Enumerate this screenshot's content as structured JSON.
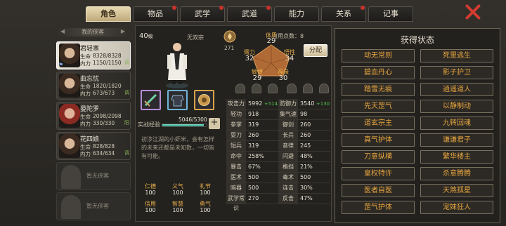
{
  "tabs": [
    {
      "label": "角色",
      "dot": false
    },
    {
      "label": "物品",
      "dot": true
    },
    {
      "label": "武学",
      "dot": true
    },
    {
      "label": "武道",
      "dot": true
    },
    {
      "label": "能力",
      "dot": false
    },
    {
      "label": "关系",
      "dot": true
    },
    {
      "label": "记事",
      "dot": false
    }
  ],
  "list_header": "我的侠客",
  "members": [
    {
      "name": "君轻寒",
      "hp_label": "生命",
      "hp": "8328/8328",
      "mp_label": "内力",
      "mp": "1150/1150",
      "tag": "调"
    },
    {
      "name": "曲忘忧",
      "hp_label": "生命",
      "hp": "1820/1820",
      "mp_label": "内力",
      "mp": "673/673",
      "tag": "调"
    },
    {
      "name": "曼陀罗",
      "hp_label": "生命",
      "hp": "2098/2098",
      "mp_label": "内力",
      "mp": "330/330",
      "tag": "阳"
    },
    {
      "name": "花四娘",
      "hp_label": "生命",
      "hp": "828/828",
      "mp_label": "内力",
      "mp": "634/634",
      "tag": "调"
    }
  ],
  "empty_slots": [
    "暂无侠客",
    "暂无侠客"
  ],
  "level": "40",
  "level_unit": "级",
  "school": "无双宗",
  "badge_value": "271",
  "points_label": "可用点数：",
  "points": "8",
  "distribute_label": "分配",
  "attrs": {
    "tizhi": {
      "label": "体质",
      "value": "29"
    },
    "biili": {
      "label": "臂力",
      "value": "32"
    },
    "wuxing": {
      "label": "悟性",
      "value": "34"
    },
    "minjie": {
      "label": "敏捷",
      "value": "29"
    },
    "fuyuan": {
      "label": "福缘",
      "value": "30"
    }
  },
  "exp_label": "实战经验",
  "exp_value": "5046/5300",
  "exp_ratio": 0.952,
  "description": "初涉江湖的小虾米，会有怎样的未来还都是未知数，一切皆有可能。",
  "small_stats": [
    {
      "label": "仁德",
      "value": "100"
    },
    {
      "label": "义气",
      "value": "100"
    },
    {
      "label": "礼节",
      "value": "100"
    },
    {
      "label": "信用",
      "value": "100"
    },
    {
      "label": "智慧",
      "value": "100"
    },
    {
      "label": "勇气",
      "value": "100"
    }
  ],
  "stats": [
    {
      "k1": "攻击力",
      "v1": "5992",
      "g1": "+514",
      "k2": "防御力",
      "v2": "3540",
      "g2": "+130"
    },
    {
      "k1": "轻功",
      "v1": "918",
      "g1": "",
      "k2": "集气速度",
      "v2": "98",
      "g2": ""
    },
    {
      "k1": "拳掌",
      "v1": "319",
      "g1": "",
      "k2": "御剑",
      "v2": "260",
      "g2": ""
    },
    {
      "k1": "耍刀",
      "v1": "260",
      "g1": "",
      "k2": "长兵",
      "v2": "260",
      "g2": ""
    },
    {
      "k1": "短兵",
      "v1": "319",
      "g1": "",
      "k2": "音律",
      "v2": "245",
      "g2": ""
    },
    {
      "k1": "命中",
      "v1": "258%",
      "g1": "",
      "k2": "闪避",
      "v2": "48%",
      "g2": ""
    },
    {
      "k1": "暴击",
      "v1": "67%",
      "g1": "",
      "k2": "格挡",
      "v2": "21%",
      "g2": ""
    },
    {
      "k1": "医术",
      "v1": "500",
      "g1": "",
      "k2": "毒术",
      "v2": "500",
      "g2": ""
    },
    {
      "k1": "暗器",
      "v1": "500",
      "g1": "",
      "k2": "连击",
      "v2": "30%",
      "g2": ""
    },
    {
      "k1": "武学常识",
      "v1": "270",
      "g1": "",
      "k2": "反击",
      "v2": "47%",
      "g2": ""
    }
  ],
  "status_title": "获得状态",
  "statuses": [
    "动无常则",
    "死里逃生",
    "碧血丹心",
    "影子护卫",
    "踏雪无痕",
    "逍遥道人",
    "先天罡气",
    "以静制动",
    "道玄宗主",
    "九转回魂",
    "真气护体",
    "谦谦君子",
    "刀意纵横",
    "繁华楼主",
    "皇权特许",
    "杀意腾腾",
    "医者自医",
    "天煞孤星",
    "罡气护体",
    "宠妹狂人"
  ]
}
